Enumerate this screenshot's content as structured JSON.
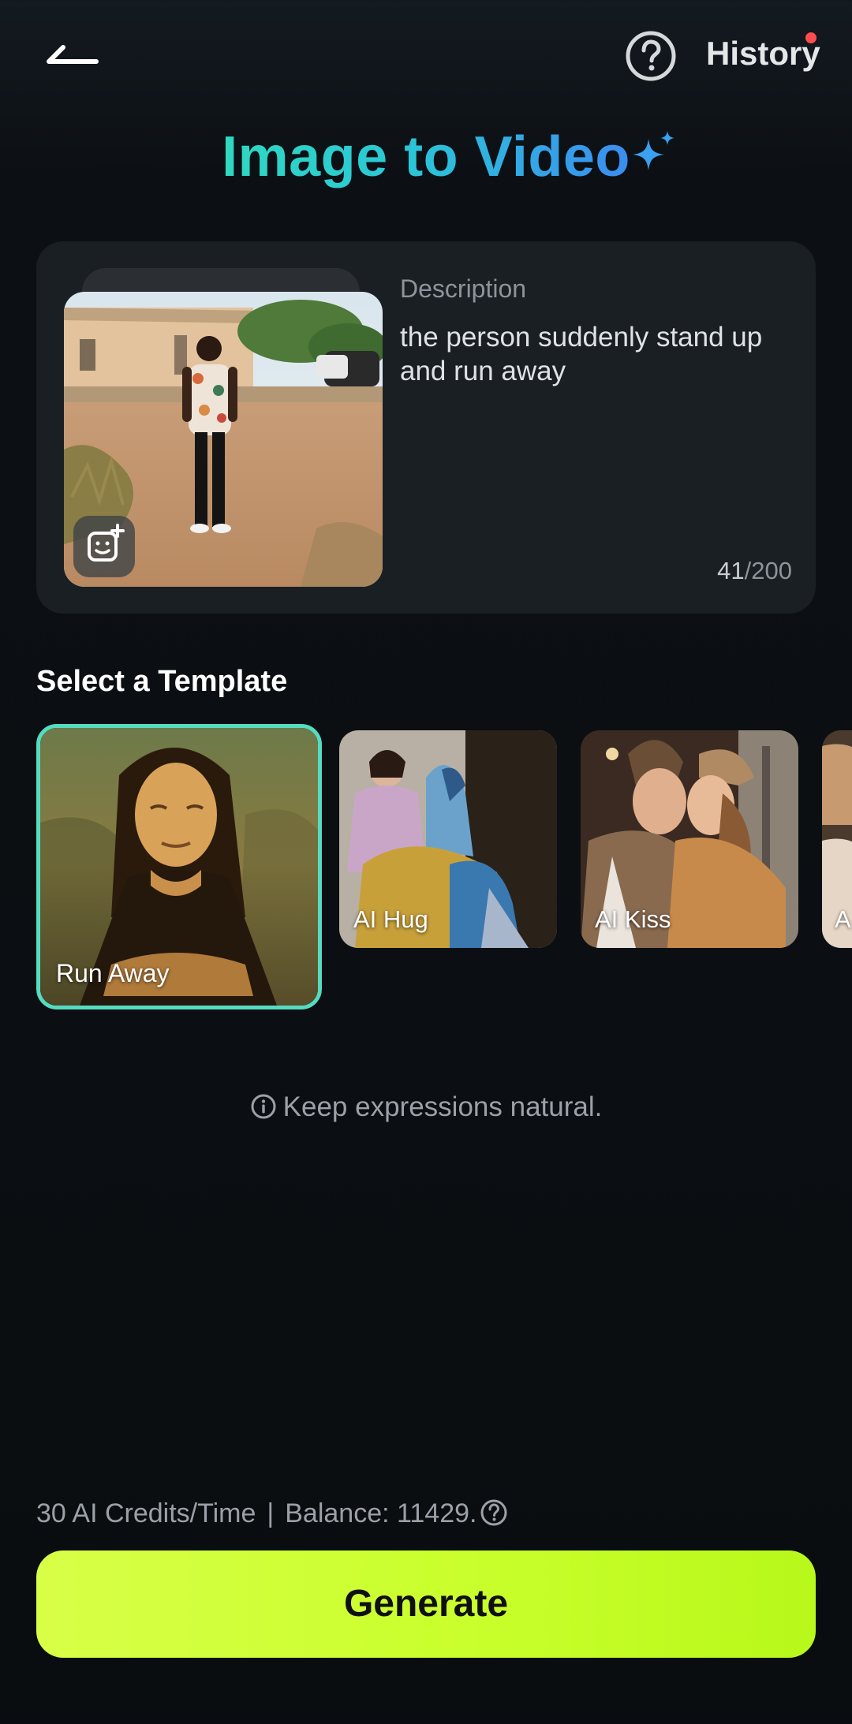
{
  "header": {
    "back_icon": "back-arrow-icon",
    "help_icon": "question-circle-icon",
    "history_label": "History",
    "history_has_notification": true,
    "notification_color": "#ff4d4f"
  },
  "page": {
    "title": "Image to Video",
    "title_icon": "sparkle-icon",
    "title_gradient": [
      "#2fd8c0",
      "#3b8df0"
    ]
  },
  "upload_card": {
    "photo_alt": "Uploaded photo of a person standing on a dirt path",
    "add_image_icon": "image-add-icon",
    "description_label": "Description",
    "description_text": "the person suddenly stand up and run away",
    "char_count": "41",
    "char_limit": "/200"
  },
  "templates": {
    "section_title": "Select a Template",
    "selected_index": 0,
    "accent_color": "#55dcc0",
    "items": [
      {
        "label": "Run Away"
      },
      {
        "label": "AI Hug"
      },
      {
        "label": "AI Kiss"
      },
      {
        "label": "A"
      }
    ]
  },
  "tip": {
    "icon": "info-circle-icon",
    "text": "Keep expressions natural."
  },
  "footer": {
    "credits_text": "30 AI Credits/Time",
    "separator": "|",
    "balance_text": "Balance: 11429.",
    "balance_help_icon": "question-circle-icon",
    "generate_label": "Generate",
    "generate_color": "#c9ff2c"
  }
}
